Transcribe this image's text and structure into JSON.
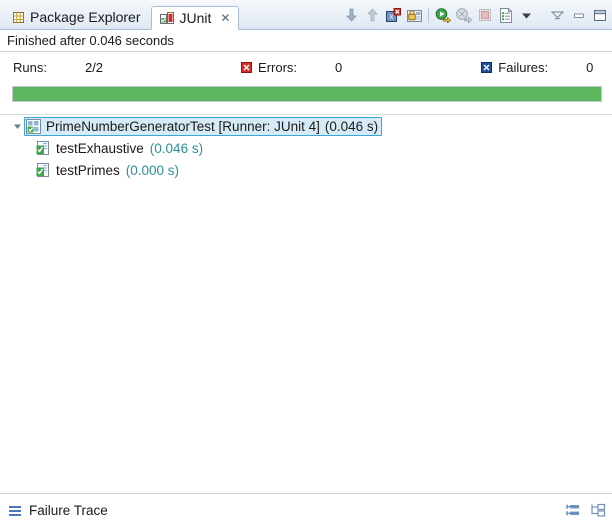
{
  "tabs": [
    {
      "label": "Package Explorer",
      "icon": "package-explorer-icon",
      "active": false,
      "closable": false
    },
    {
      "label": "JUnit",
      "icon": "junit-icon",
      "active": true,
      "closable": true,
      "close_glyph": "✕"
    }
  ],
  "toolbar": {
    "items": [
      {
        "name": "next-failure-button",
        "icon": "arrow-down-icon",
        "title": "Next Failed Test"
      },
      {
        "name": "previous-failure-button",
        "icon": "arrow-up-icon",
        "title": "Previous Failed Test"
      },
      {
        "name": "show-failures-only-button",
        "icon": "show-failures-only-icon",
        "title": "Show Failures Only"
      },
      {
        "name": "scroll-lock-button",
        "icon": "scroll-lock-icon",
        "title": "Scroll Lock"
      },
      {
        "name": "separator-1",
        "icon": "separator",
        "title": ""
      },
      {
        "name": "rerun-test-button",
        "icon": "rerun-test-icon",
        "title": "Rerun Test"
      },
      {
        "name": "rerun-failed-tests-button",
        "icon": "rerun-failed-tests-icon",
        "title": "Rerun Test - Failures First"
      },
      {
        "name": "stop-button",
        "icon": "stop-icon",
        "title": "Stop JUnit Test Run"
      },
      {
        "name": "test-run-history-button",
        "icon": "test-run-history-icon",
        "title": "Test Run History"
      },
      {
        "name": "history-dropdown-button",
        "icon": "chevron-down-icon",
        "title": "Test Run History Menu"
      },
      {
        "name": "view-menu-button",
        "icon": "view-menu-icon",
        "title": "View Menu"
      },
      {
        "name": "minimize-button",
        "icon": "minimize-icon",
        "title": "Minimize"
      },
      {
        "name": "maximize-button",
        "icon": "maximize-icon",
        "title": "Maximize"
      }
    ]
  },
  "status": {
    "text": "Finished after 0.046 seconds"
  },
  "counters": {
    "runs": {
      "label": "Runs:",
      "value": "2/2"
    },
    "errors": {
      "label": "Errors:",
      "value": "0",
      "icon": "error-marker-icon",
      "color": "#d93025"
    },
    "failures": {
      "label": "Failures:",
      "value": "0",
      "icon": "failure-marker-icon",
      "color": "#1f4fa0"
    }
  },
  "progress": {
    "percent": 100,
    "color": "#5cb85f",
    "state": "passed"
  },
  "tree": {
    "root": {
      "name": "PrimeNumberGeneratorTest [Runner: JUnit 4]",
      "time": "(0.046 s)",
      "icon": "test-suite-ok-icon",
      "selected": true,
      "expanded": true
    },
    "children": [
      {
        "name": "testExhaustive",
        "time": "(0.046 s)",
        "icon": "test-ok-icon"
      },
      {
        "name": "testPrimes",
        "time": "(0.000 s)",
        "icon": "test-ok-icon"
      }
    ]
  },
  "footer": {
    "title": "Failure Trace",
    "icon": "failure-trace-icon",
    "tools": [
      {
        "name": "compare-results-button",
        "icon": "compare-results-icon"
      },
      {
        "name": "filter-stack-trace-button",
        "icon": "filter-stack-trace-icon"
      }
    ]
  }
}
